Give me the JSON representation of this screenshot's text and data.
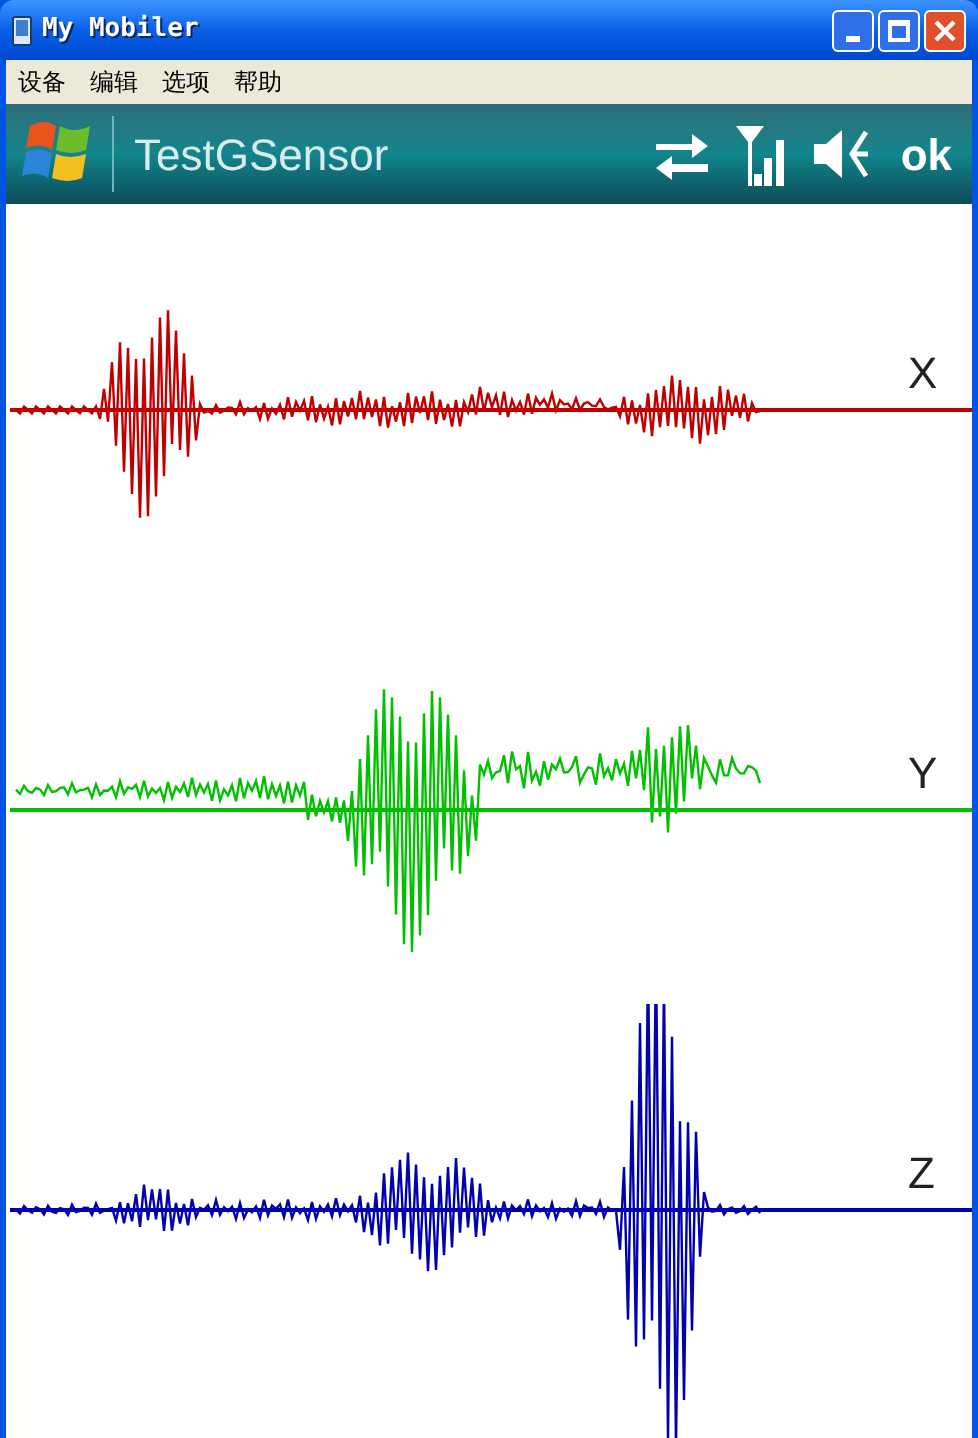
{
  "window": {
    "title": "My Mobiler"
  },
  "menu": [
    "设备",
    "编辑",
    "选项",
    "帮助"
  ],
  "app_bar": {
    "title": "TestGSensor",
    "ok": "ok"
  },
  "channels": [
    {
      "label": "X",
      "color": "#c00000"
    },
    {
      "label": "Y",
      "color": "#00c000"
    },
    {
      "label": "Z",
      "color": "#0000b0"
    }
  ]
}
